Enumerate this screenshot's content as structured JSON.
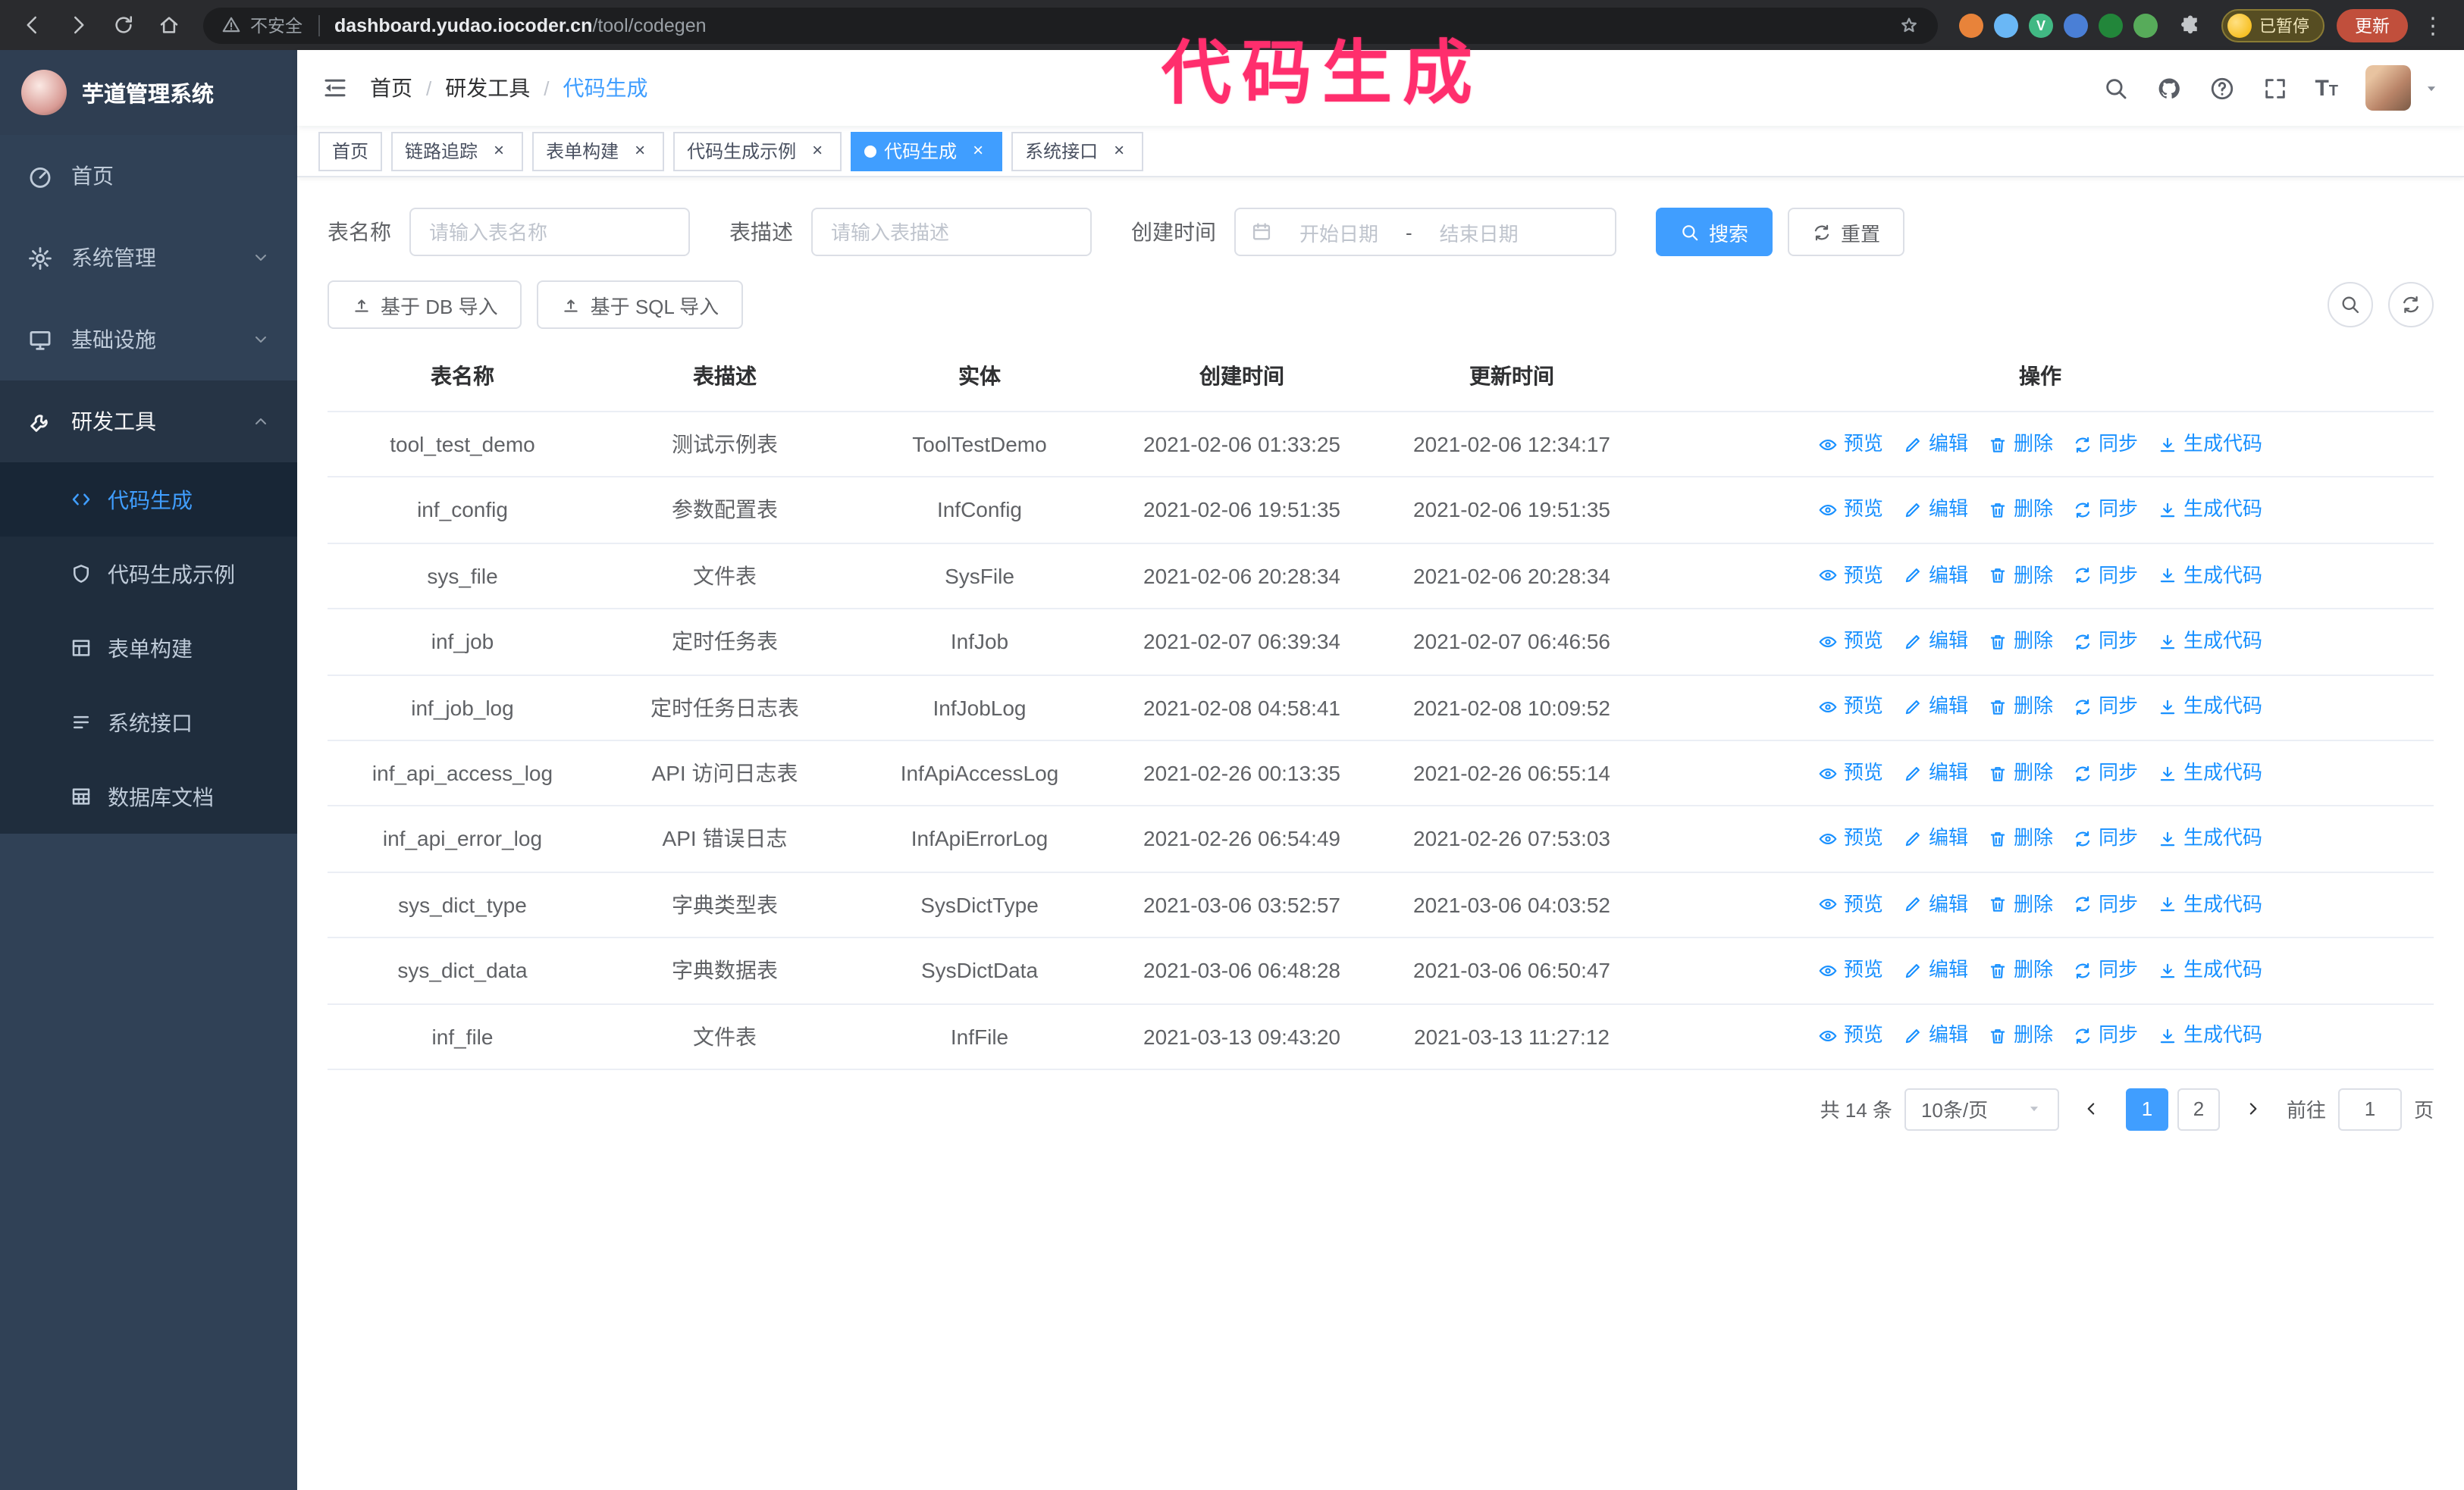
{
  "browser": {
    "security_label": "不安全",
    "url_domain": "dashboard.yudao.iocoder.cn",
    "url_path": "/tool/codegen",
    "profile_badge": "已暂停",
    "update_button": "更新",
    "extensions": [
      {
        "name": "extension-orange-icon",
        "color": "#e8833a"
      },
      {
        "name": "extension-blue-icon",
        "color": "#6ab7f5"
      },
      {
        "name": "extension-vue-icon",
        "color": "#41b883",
        "glyph": "V"
      },
      {
        "name": "extension-people-icon",
        "color": "#4a7fd6"
      },
      {
        "name": "extension-terminal-icon",
        "color": "#22863a"
      },
      {
        "name": "extension-leaf-icon",
        "color": "#57ab5a"
      }
    ]
  },
  "annotation": {
    "text": "代码生成",
    "color": "#ff2e6d"
  },
  "sidebar": {
    "logo_title": "芋道管理系统",
    "items": [
      {
        "label": "首页",
        "icon": "dashboard-icon",
        "expandable": false
      },
      {
        "label": "系统管理",
        "icon": "gear-icon",
        "expandable": true
      },
      {
        "label": "基础设施",
        "icon": "monitor-icon",
        "expandable": true
      },
      {
        "label": "研发工具",
        "icon": "tools-icon",
        "expandable": true,
        "expanded": true
      }
    ],
    "subitems": [
      {
        "label": "代码生成",
        "icon": "code-icon",
        "active": true
      },
      {
        "label": "代码生成示例",
        "icon": "shield-icon"
      },
      {
        "label": "表单构建",
        "icon": "form-icon"
      },
      {
        "label": "系统接口",
        "icon": "api-icon"
      },
      {
        "label": "数据库文档",
        "icon": "database-icon"
      }
    ]
  },
  "header": {
    "breadcrumb": [
      "首页",
      "研发工具",
      "代码生成"
    ]
  },
  "tabs": [
    {
      "label": "首页",
      "closable": false,
      "active": false
    },
    {
      "label": "链路追踪",
      "closable": true,
      "active": false
    },
    {
      "label": "表单构建",
      "closable": true,
      "active": false
    },
    {
      "label": "代码生成示例",
      "closable": true,
      "active": false
    },
    {
      "label": "代码生成",
      "closable": true,
      "active": true
    },
    {
      "label": "系统接口",
      "closable": true,
      "active": false
    }
  ],
  "filters": {
    "table_name_label": "表名称",
    "table_name_placeholder": "请输入表名称",
    "table_desc_label": "表描述",
    "table_desc_placeholder": "请输入表描述",
    "create_time_label": "创建时间",
    "date_start_placeholder": "开始日期",
    "date_separator": "-",
    "date_end_placeholder": "结束日期",
    "search_button": "搜索",
    "reset_button": "重置"
  },
  "toolbar": {
    "import_db_button": "基于 DB 导入",
    "import_sql_button": "基于 SQL 导入"
  },
  "table": {
    "headers": [
      "表名称",
      "表描述",
      "实体",
      "创建时间",
      "更新时间",
      "操作"
    ],
    "actions": [
      {
        "label": "预览",
        "icon": "eye-icon",
        "name": "preview-action"
      },
      {
        "label": "编辑",
        "icon": "pencil-icon",
        "name": "edit-action"
      },
      {
        "label": "删除",
        "icon": "trash-icon",
        "name": "delete-action"
      },
      {
        "label": "同步",
        "icon": "sync-icon",
        "name": "sync-action"
      },
      {
        "label": "生成代码",
        "icon": "download-icon",
        "name": "generate-code-action"
      }
    ],
    "rows": [
      {
        "name": "tool_test_demo",
        "desc": "测试示例表",
        "entity": "ToolTestDemo",
        "created": "2021-02-06 01:33:25",
        "updated": "2021-02-06 12:34:17"
      },
      {
        "name": "inf_config",
        "desc": "参数配置表",
        "entity": "InfConfig",
        "created": "2021-02-06 19:51:35",
        "updated": "2021-02-06 19:51:35"
      },
      {
        "name": "sys_file",
        "desc": "文件表",
        "entity": "SysFile",
        "created": "2021-02-06 20:28:34",
        "updated": "2021-02-06 20:28:34"
      },
      {
        "name": "inf_job",
        "desc": "定时任务表",
        "entity": "InfJob",
        "created": "2021-02-07 06:39:34",
        "updated": "2021-02-07 06:46:56"
      },
      {
        "name": "inf_job_log",
        "desc": "定时任务日志表",
        "entity": "InfJobLog",
        "created": "2021-02-08 04:58:41",
        "updated": "2021-02-08 10:09:52"
      },
      {
        "name": "inf_api_access_log",
        "desc": "API 访问日志表",
        "entity": "InfApiAccessLog",
        "created": "2021-02-26 00:13:35",
        "updated": "2021-02-26 06:55:14"
      },
      {
        "name": "inf_api_error_log",
        "desc": "API 错误日志",
        "entity": "InfApiErrorLog",
        "created": "2021-02-26 06:54:49",
        "updated": "2021-02-26 07:53:03"
      },
      {
        "name": "sys_dict_type",
        "desc": "字典类型表",
        "entity": "SysDictType",
        "created": "2021-03-06 03:52:57",
        "updated": "2021-03-06 04:03:52"
      },
      {
        "name": "sys_dict_data",
        "desc": "字典数据表",
        "entity": "SysDictData",
        "created": "2021-03-06 06:48:28",
        "updated": "2021-03-06 06:50:47"
      },
      {
        "name": "inf_file",
        "desc": "文件表",
        "entity": "InfFile",
        "created": "2021-03-13 09:43:20",
        "updated": "2021-03-13 11:27:12"
      }
    ]
  },
  "pagination": {
    "total_label": "共 14 条",
    "page_size": "10条/页",
    "pages": [
      "1",
      "2"
    ],
    "current_page": "1",
    "goto_label": "前往",
    "goto_value": "1",
    "goto_suffix": "页"
  },
  "colors": {
    "accent_blue": "#409eff",
    "link_blue": "#1890ff",
    "sidebar_bg": "#304156",
    "submenu_bg": "#1f2d3d",
    "annotation_pink": "#ff2e6d",
    "active_tab_bg": "#409eff"
  }
}
